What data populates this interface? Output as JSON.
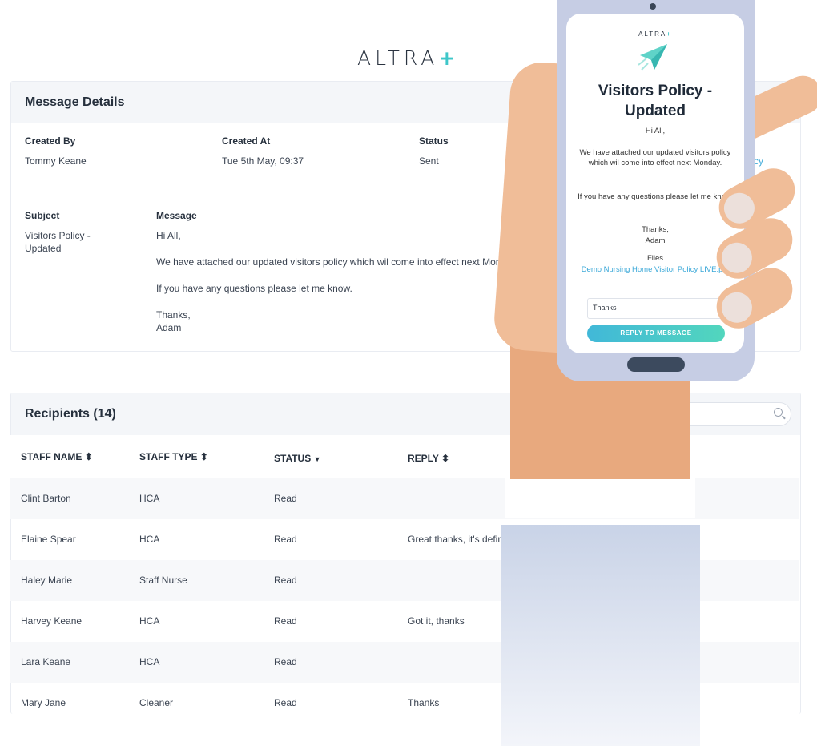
{
  "brand": {
    "name": "ALTRA",
    "plus": "+"
  },
  "details": {
    "heading": "Message Details",
    "created_by_label": "Created By",
    "created_by": "Tommy Keane",
    "created_at_label": "Created At",
    "created_at": "Tue 5th May, 09:37",
    "status_label": "Status",
    "status": "Sent",
    "file_fragment": "cy",
    "subject_label": "Subject",
    "subject": "Visitors Policy - Updated",
    "message_label": "Message",
    "message_lines": [
      "Hi All,",
      "We have attached our updated visitors policy which wil come into effect next Mon",
      "If you have any questions please let me know.",
      "Thanks,",
      "Adam"
    ]
  },
  "recipients": {
    "heading": "Recipients (14)",
    "columns": [
      {
        "label": "STAFF NAME",
        "icon": "sort-icon"
      },
      {
        "label": "STAFF TYPE",
        "icon": "sort-icon"
      },
      {
        "label": "STATUS",
        "icon": "sort-desc-icon"
      },
      {
        "label": "REPLY",
        "icon": "sort-icon"
      }
    ],
    "rows": [
      {
        "name": "Clint Barton",
        "type": "HCA",
        "status": "Read",
        "reply": ""
      },
      {
        "name": "Elaine Spear",
        "type": "HCA",
        "status": "Read",
        "reply": "Great thanks, it's defin"
      },
      {
        "name": "Haley Marie",
        "type": "Staff Nurse",
        "status": "Read",
        "reply": ""
      },
      {
        "name": "Harvey Keane",
        "type": "HCA",
        "status": "Read",
        "reply": "Got it, thanks"
      },
      {
        "name": "Lara Keane",
        "type": "HCA",
        "status": "Read",
        "reply": ""
      },
      {
        "name": "Mary Jane",
        "type": "Cleaner",
        "status": "Read",
        "reply": "Thanks"
      }
    ]
  },
  "phone": {
    "brand": "ALTRA",
    "brand_plus": "+",
    "title": "Visitors Policy - Updated",
    "greeting": "Hi All,",
    "body": "We have attached our updated visitors policy which wil come into effect next Monday.",
    "questions": "If you have any questions please let me know.",
    "signoff": "Thanks,",
    "sender": "Adam",
    "files_label": "Files",
    "file_name": "Demo Nursing Home Visitor Policy LIVE.pdf",
    "reply_value": "Thanks",
    "reply_button": "REPLY TO MESSAGE"
  },
  "colors": {
    "accent": "#3ec7c9",
    "link": "#3aa8d8",
    "skin": "#f0bd98",
    "phone_frame": "#c6cde4"
  }
}
